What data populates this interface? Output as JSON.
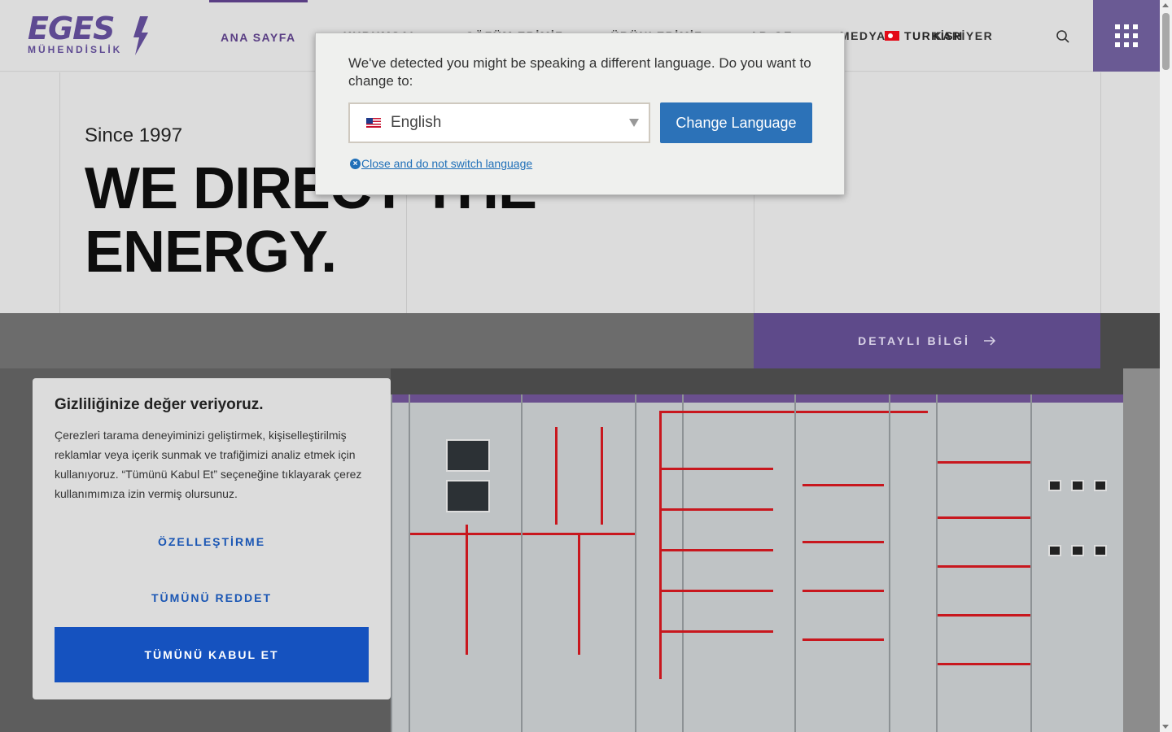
{
  "header": {
    "logo_text": "EGES",
    "logo_sub": "MÜHENDİSLİK",
    "nav": [
      {
        "label": "ANA SAYFA",
        "active": true
      },
      {
        "label": "KURUMSAL"
      },
      {
        "label": "ÇÖZÜM ERİMİZ"
      },
      {
        "label": "ÜRÜNLERİMİZ"
      },
      {
        "label": "AR-GE"
      },
      {
        "label": "MEDYA"
      },
      {
        "label": "KARİYER"
      }
    ],
    "language_label": "TURKİSH"
  },
  "hero": {
    "since": "Since 1997",
    "headline_line1": "WE DIRECT THE",
    "headline_line2": "ENERGY.",
    "detail_button": "DETAYLI BİLGİ"
  },
  "language_modal": {
    "message": "We've detected you might be speaking a different language. Do you want to change to:",
    "selected_language": "English",
    "change_button": "Change Language",
    "close_link": "Close and do not switch language"
  },
  "cookie_banner": {
    "title": "Gizliliğinize değer veriyoruz.",
    "body": "Çerezleri tarama deneyiminizi geliştirmek, kişiselleştirilmiş reklamlar veya içerik sunmak ve trafiğimizi analiz etmek için kullanıyoruz. “Tümünü Kabul Et” seçeneğine tıklayarak çerez kullanımımıza izin vermiş olursunuz.",
    "customize": "ÖZELLEŞTİRME",
    "reject_all": "TÜMÜNÜ REDDET",
    "accept_all": "TÜMÜNÜ KABUL ET"
  },
  "colors": {
    "brand_purple": "#5e4a8a",
    "accept_blue": "#1552bf",
    "change_blue": "#2c72b8"
  }
}
